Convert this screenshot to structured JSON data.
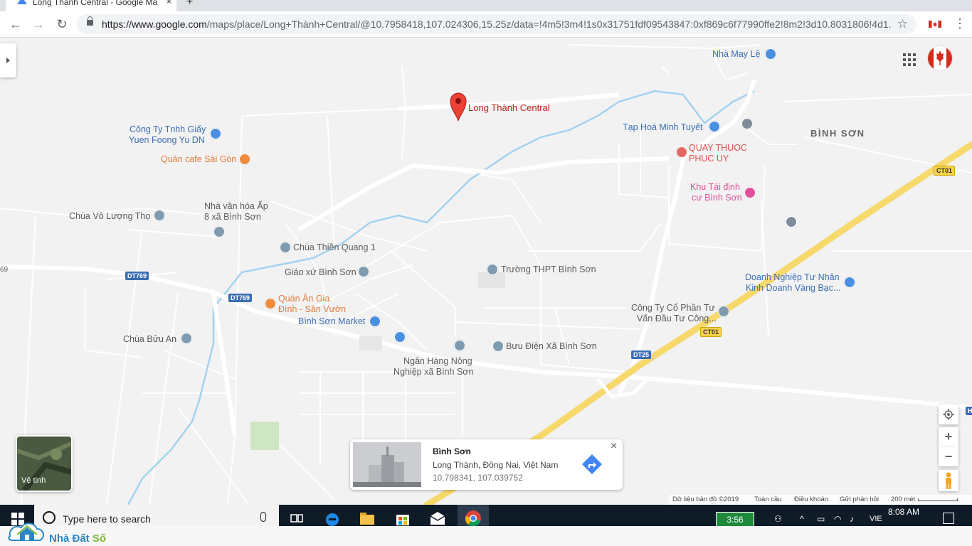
{
  "browser": {
    "tab_title": "Long Thành Central - Google Ma",
    "tab_close": "×",
    "new_tab": "+",
    "url_host": "https://www.google.com",
    "url_rest": "/maps/place/Long+Thành+Central/@10.7958418,107.024306,15.25z/data=!4m5!3m4!1s0x31751fdf09543847:0xf869c6f77990ffe2!8m2!3d10.8031806!4d1..."
  },
  "map": {
    "selected_place": "Long Thành Central",
    "area_label": "BÌNH SƠN",
    "edge_label": "69",
    "pois": [
      {
        "id": "nha-may-le",
        "text": "Nhà May Lệ",
        "style": "poi-blue"
      },
      {
        "id": "cong-ty-giay-1",
        "text": "Công Ty Tnhh Giấy",
        "style": "poi-blue"
      },
      {
        "id": "cong-ty-giay-2",
        "text": "Yuen Foong Yu DN",
        "style": "poi-blue"
      },
      {
        "id": "quan-cafe",
        "text": "Quán cafe Sài Gòn",
        "style": "poi-orange"
      },
      {
        "id": "tap-hoa",
        "text": "Tạp Hoá Minh Tuyết",
        "style": "poi-blue"
      },
      {
        "id": "quay-thuoc-1",
        "text": "QUAY THUOC",
        "style": "poi-red"
      },
      {
        "id": "quay-thuoc-2",
        "text": "PHUC UY",
        "style": "poi-red"
      },
      {
        "id": "khu-tai-dinh-cu-1",
        "text": "Khu Tái định",
        "style": "poi-pink"
      },
      {
        "id": "khu-tai-dinh-cu-2",
        "text": "cư Bình Sơn",
        "style": "poi-pink"
      },
      {
        "id": "nha-van-hoa-1",
        "text": "Nhà văn hóa Ấp",
        "style": "poi-gray"
      },
      {
        "id": "nha-van-hoa-2",
        "text": "8 xã Bình Sơn",
        "style": "poi-gray"
      },
      {
        "id": "chua-vo-luong-tho",
        "text": "Chùa Vô Lượng Thọ",
        "style": "poi-gray"
      },
      {
        "id": "chua-thien-quang",
        "text": "Chùa Thiền Quang 1",
        "style": "poi-gray"
      },
      {
        "id": "giao-xu",
        "text": "Giáo xứ Bình Sơn",
        "style": "poi-gray"
      },
      {
        "id": "truong-thpt",
        "text": "Trường THPT Bình Sơn",
        "style": "poi-gray"
      },
      {
        "id": "dn-tu-nhan-1",
        "text": "Doanh Nghiệp Tư Nhân",
        "style": "poi-blue"
      },
      {
        "id": "dn-tu-nhan-2",
        "text": "Kinh Doanh Vàng Bạc...",
        "style": "poi-blue"
      },
      {
        "id": "quan-an-1",
        "text": "Quán Ăn Gia",
        "style": "poi-orange"
      },
      {
        "id": "quan-an-2",
        "text": "Đình - Sân Vườn",
        "style": "poi-orange"
      },
      {
        "id": "binh-son-market",
        "text": "Bình Sơn Market",
        "style": "poi-blue"
      },
      {
        "id": "cong-ty-cp-1",
        "text": "Công Ty Cổ Phần Tư",
        "style": "poi-gray"
      },
      {
        "id": "cong-ty-cp-2",
        "text": "Vấn Đầu Tư Công...",
        "style": "poi-gray"
      },
      {
        "id": "chua-buu-an",
        "text": "Chùa Bửu An",
        "style": "poi-gray"
      },
      {
        "id": "buu-dien",
        "text": "Bưu Điện Xã Bình Sơn",
        "style": "poi-gray"
      },
      {
        "id": "ngan-hang-1",
        "text": "Ngân Hàng Nông",
        "style": "poi-gray"
      },
      {
        "id": "ngan-hang-2",
        "text": "Nghiệp xã Bình Sơn",
        "style": "poi-gray"
      }
    ],
    "road_shields": [
      {
        "id": "dt769-a",
        "text": "DT769",
        "kind": "shield-blue"
      },
      {
        "id": "dt769-b",
        "text": "DT769",
        "kind": "shield-blue"
      },
      {
        "id": "ct01-a",
        "text": "CT01",
        "kind": "shield-yellow"
      },
      {
        "id": "ct01-b",
        "text": "CT01",
        "kind": "shield-yellow"
      },
      {
        "id": "dt25",
        "text": "DT25",
        "kind": "shield-blue"
      },
      {
        "id": "edge-h",
        "text": "H",
        "kind": "shield-blue"
      }
    ],
    "satellite_label": "Vệ tinh",
    "zoom_in": "+",
    "zoom_out": "−",
    "info_card": {
      "title": "Bình Sơn",
      "address": "Long Thành, Đồng Nai, Việt Nam",
      "coords": "10.798341, 107.039752",
      "close": "×"
    },
    "attribution": {
      "data": "Dữ liệu bản đồ ©2019",
      "global": "Toàn cầu",
      "terms": "Điều khoản",
      "feedback": "Gửi phản hồi",
      "scale": "200 mét"
    }
  },
  "taskbar": {
    "search_placeholder": "Type here to search",
    "battery": "3:56",
    "lang": "VIE",
    "time": "8:08 AM"
  },
  "watermark": {
    "brand": "Nhà Đất ",
    "brand_accent": "Số"
  },
  "colors": {
    "pin_red": "#ea4335",
    "road_yellow": "#f6d86b",
    "river_blue": "#a4d2f0",
    "accent_blue": "#4285f4"
  }
}
